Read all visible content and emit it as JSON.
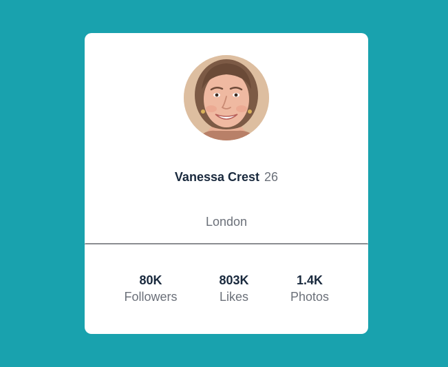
{
  "profile": {
    "name": "Vanessa Crest",
    "age": "26",
    "city": "London"
  },
  "stats": [
    {
      "value": "80K",
      "label": "Followers"
    },
    {
      "value": "803K",
      "label": "Likes"
    },
    {
      "value": "1.4K",
      "label": "Photos"
    }
  ],
  "colors": {
    "background": "#19a2ae",
    "card": "#ffffff",
    "primary_text": "#19293d",
    "secondary_text": "#6b7079",
    "divider": "#8a8c90"
  },
  "icons": {
    "avatar": "profile-photo"
  }
}
